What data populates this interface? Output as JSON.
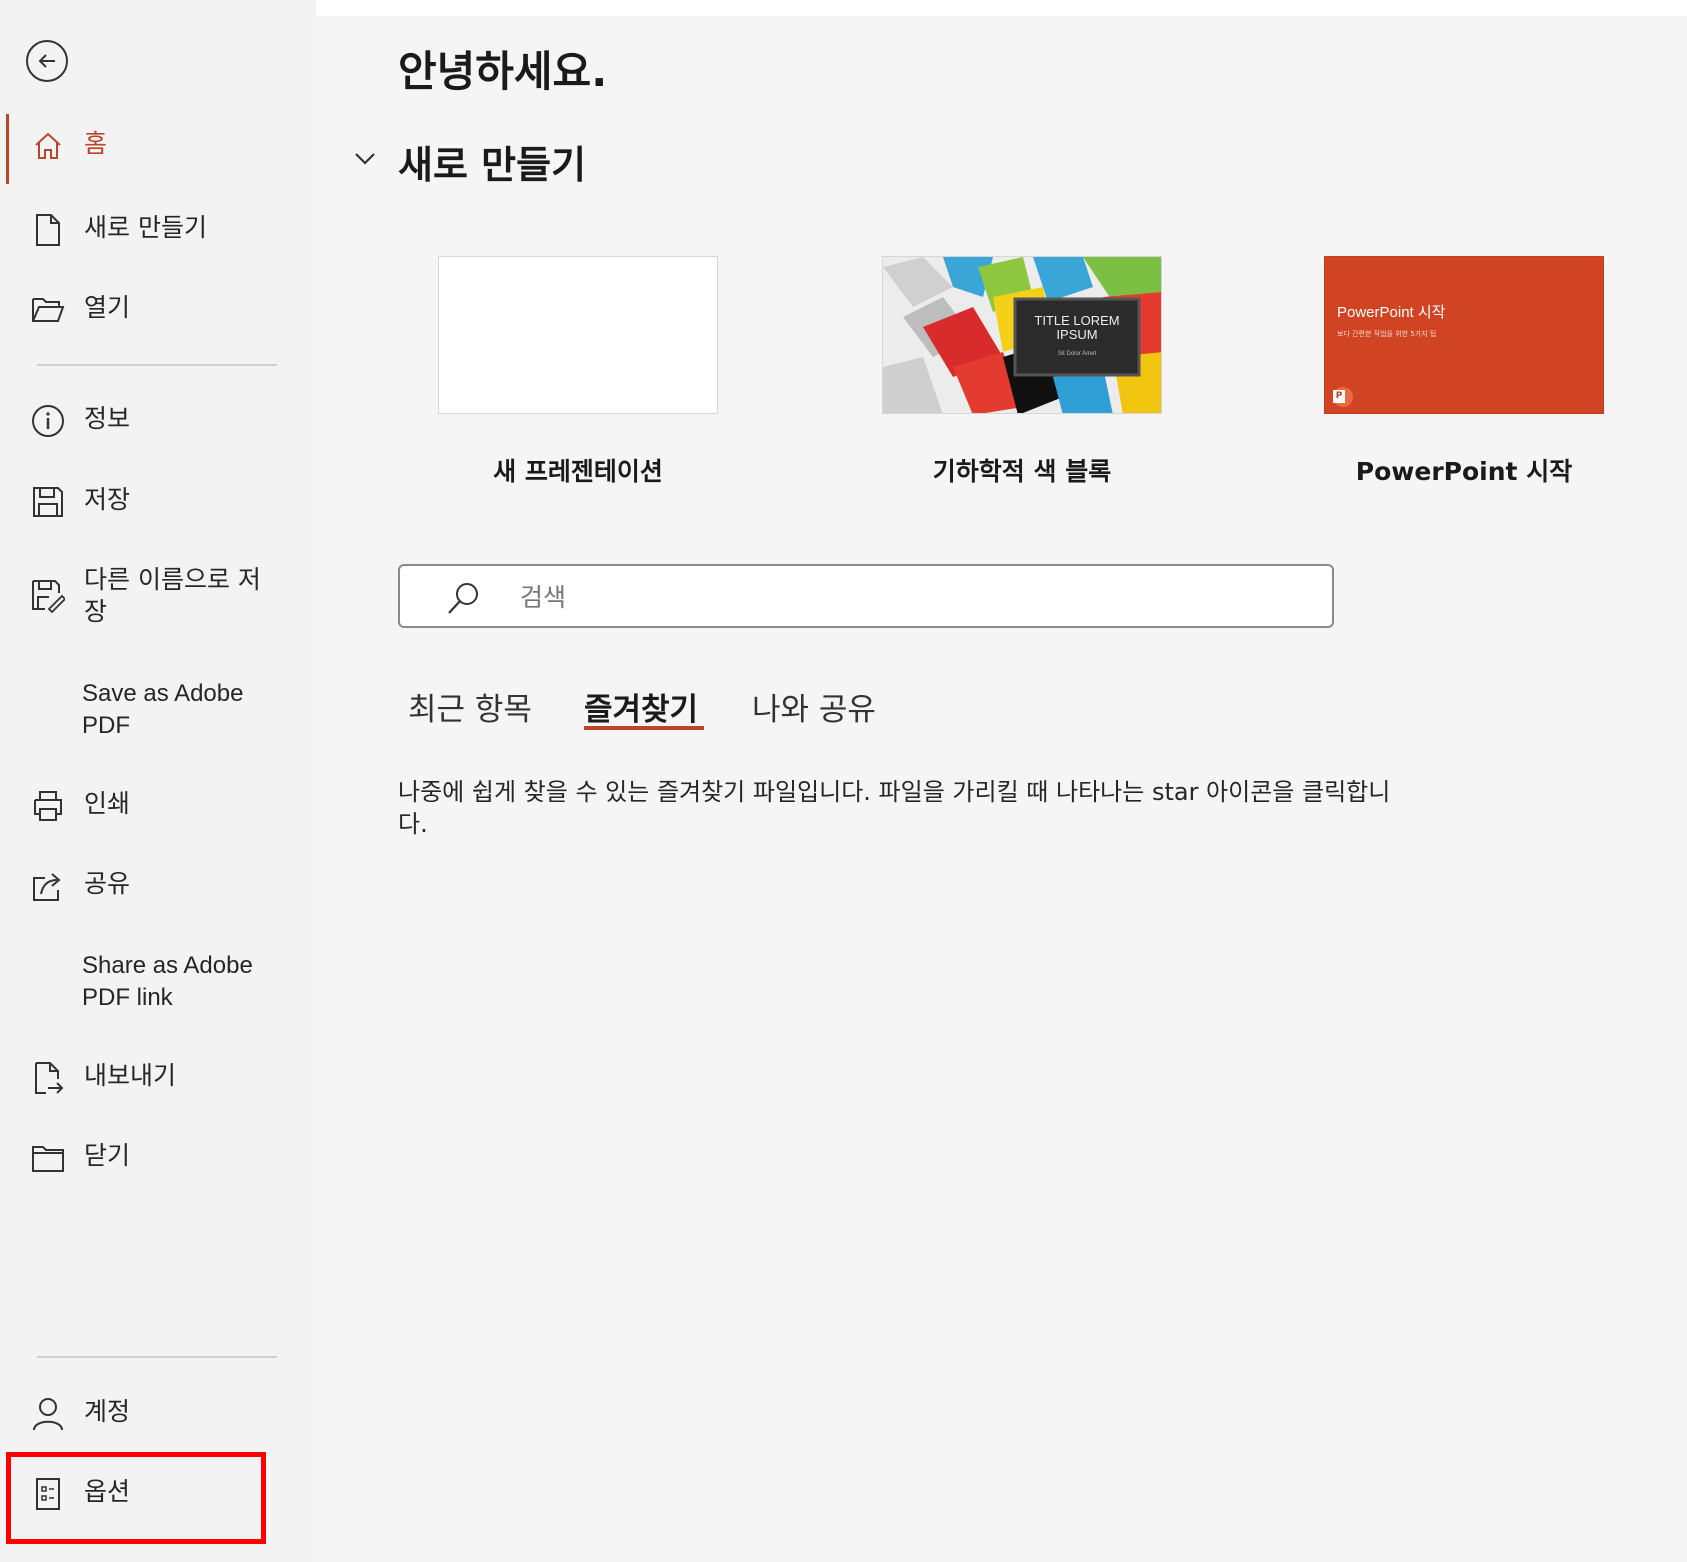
{
  "sidebar": {
    "items": [
      {
        "label": "홈",
        "icon": "home-icon",
        "active": true
      },
      {
        "label": "새로 만들기",
        "icon": "new-document-icon"
      },
      {
        "label": "열기",
        "icon": "folder-open-icon"
      },
      {
        "label": "정보",
        "icon": "info-icon"
      },
      {
        "label": "저장",
        "icon": "save-icon"
      },
      {
        "label": "다른 이름으로 저장",
        "icon": "save-as-icon"
      },
      {
        "label": "Save as Adobe PDF"
      },
      {
        "label": "인쇄",
        "icon": "printer-icon"
      },
      {
        "label": "공유",
        "icon": "share-icon"
      },
      {
        "label": "Share as Adobe PDF link"
      },
      {
        "label": "내보내기",
        "icon": "export-icon"
      },
      {
        "label": "닫기",
        "icon": "close-folder-icon"
      },
      {
        "label": "계정",
        "icon": "account-icon"
      },
      {
        "label": "옵션",
        "icon": "options-icon"
      }
    ]
  },
  "main": {
    "greeting": "안녕하세요.",
    "new_section_title": "새로 만들기",
    "templates": [
      {
        "label": "새 프레젠테이션"
      },
      {
        "label": "기하학적 색 블록",
        "thumb_title": "TITLE LOREM IPSUM",
        "thumb_subtitle": "Sit Dolor Amet"
      },
      {
        "label": "PowerPoint 시작",
        "thumb_title": "PowerPoint 시작",
        "thumb_subtitle": "보다 간편한 작업을 위한 5가지 팁"
      }
    ],
    "search_placeholder": "검색",
    "tabs": [
      {
        "label": "최근 항목"
      },
      {
        "label": "즐겨찾기",
        "active": true
      },
      {
        "label": "나와 공유"
      }
    ],
    "info_text": "나중에 쉽게 찾을 수 있는 즐겨찾기 파일입니다. 파일을 가리킬 때 나타나는 star 아이콘을 클릭합니다."
  },
  "colors": {
    "accent": "#b7472a",
    "highlight": "#ff0000",
    "powerpoint_orange": "#d04423"
  }
}
